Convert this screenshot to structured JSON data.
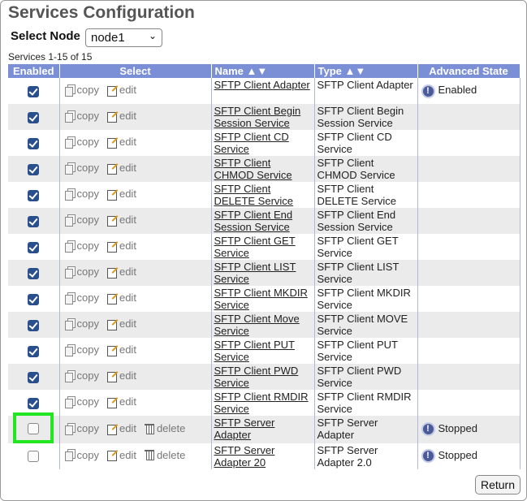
{
  "page": {
    "title": "Services Configuration"
  },
  "node": {
    "label": "Select Node",
    "value": "node1"
  },
  "count_text": "Services 1-15 of 15",
  "columns": {
    "enabled": "Enabled",
    "select": "Select",
    "name": "Name ▲▼",
    "type": "Type ▲▼",
    "advanced": "Advanced State"
  },
  "actions": {
    "copy": "copy",
    "edit": "edit",
    "delete": "delete"
  },
  "rows": [
    {
      "enabled": true,
      "name": "SFTP Client Adapter",
      "type": "SFTP Client Adapter",
      "state": "Enabled",
      "deletable": false
    },
    {
      "enabled": true,
      "name": "SFTP Client Begin Session Service",
      "type": "SFTP Client Begin Session Service",
      "state": "",
      "deletable": false
    },
    {
      "enabled": true,
      "name": "SFTP Client CD Service",
      "type": "SFTP Client CD Service",
      "state": "",
      "deletable": false
    },
    {
      "enabled": true,
      "name": "SFTP Client CHMOD Service",
      "type": "SFTP Client CHMOD Service",
      "state": "",
      "deletable": false
    },
    {
      "enabled": true,
      "name": "SFTP Client DELETE Service",
      "type": "SFTP Client DELETE Service",
      "state": "",
      "deletable": false
    },
    {
      "enabled": true,
      "name": "SFTP Client End Session Service",
      "type": "SFTP Client End Session Service",
      "state": "",
      "deletable": false
    },
    {
      "enabled": true,
      "name": "SFTP Client GET Service",
      "type": "SFTP Client GET Service",
      "state": "",
      "deletable": false
    },
    {
      "enabled": true,
      "name": "SFTP Client LIST Service",
      "type": "SFTP Client LIST Service",
      "state": "",
      "deletable": false
    },
    {
      "enabled": true,
      "name": "SFTP Client MKDIR Service",
      "type": "SFTP Client MKDIR Service",
      "state": "",
      "deletable": false
    },
    {
      "enabled": true,
      "name": "SFTP Client Move Service",
      "type": "SFTP Client MOVE Service",
      "state": "",
      "deletable": false
    },
    {
      "enabled": true,
      "name": "SFTP Client PUT Service",
      "type": "SFTP Client PUT Service",
      "state": "",
      "deletable": false
    },
    {
      "enabled": true,
      "name": "SFTP Client PWD Service",
      "type": "SFTP Client PWD Service",
      "state": "",
      "deletable": false
    },
    {
      "enabled": true,
      "name": "SFTP Client RMDIR Service",
      "type": "SFTP Client RMDIR Service",
      "state": "",
      "deletable": false
    },
    {
      "enabled": false,
      "name": "SFTP Server Adapter",
      "type": "SFTP Server Adapter",
      "state": "Stopped",
      "deletable": true,
      "highlight": true
    },
    {
      "enabled": false,
      "name": "SFTP Server Adapter 20",
      "type": "SFTP Server Adapter 2.0",
      "state": "Stopped",
      "deletable": true
    }
  ],
  "return_button": "Return",
  "colors": {
    "header_bg": "#7b8fd6",
    "highlight": "#22e622",
    "checkbox_on": "#2b4f8c"
  }
}
